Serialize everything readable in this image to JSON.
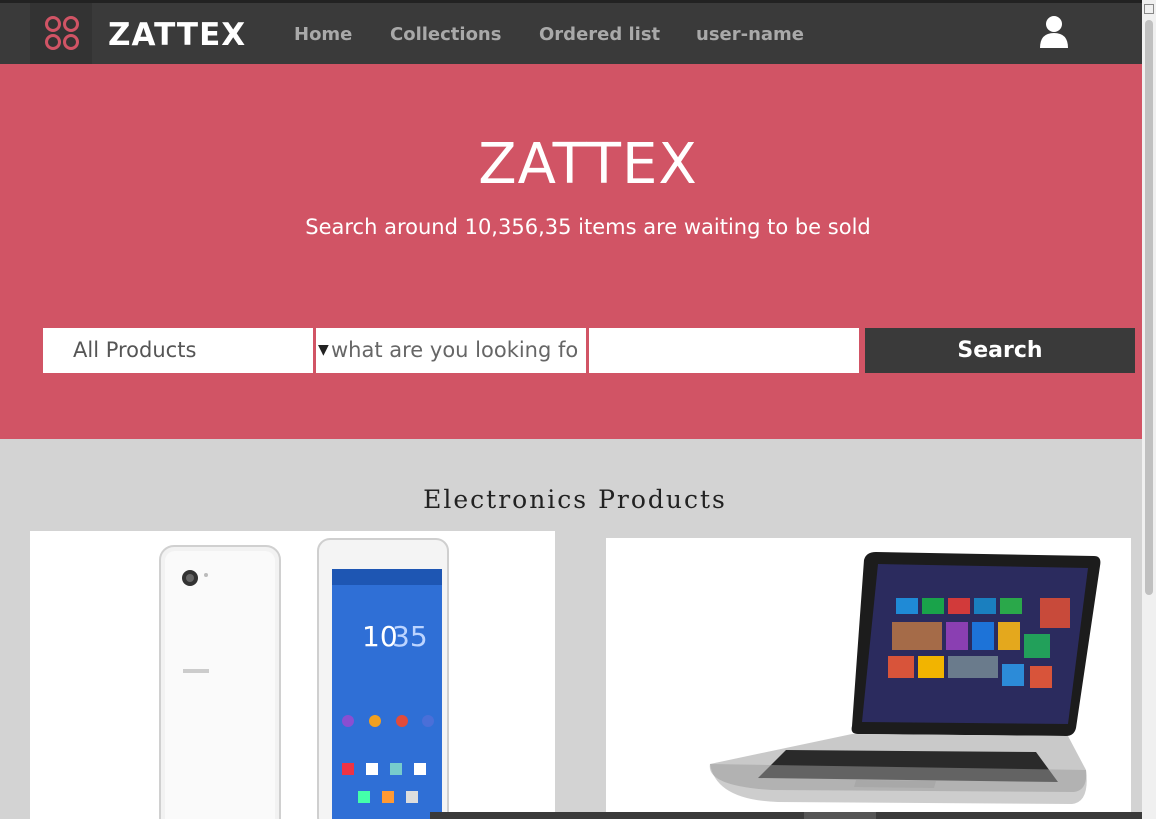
{
  "app": {
    "brand": "ZATTEX",
    "accent": "#d15465",
    "nav_bg": "#3a3a3a",
    "logo_icon": "four-rings-icon",
    "user_icon": "user-icon"
  },
  "nav": {
    "items": [
      {
        "label": "Home"
      },
      {
        "label": "Collections"
      },
      {
        "label": "Ordered list"
      },
      {
        "label": "user-name"
      }
    ]
  },
  "hero": {
    "title": "ZATTEX",
    "subtitle": "Search around 10,356,35 items are waiting to be sold"
  },
  "search": {
    "category_value": "All Products",
    "placeholder": "what are you looking fo",
    "button_label": "Search"
  },
  "section": {
    "title": "Electronics Products",
    "products": [
      {
        "image": "sony-xperia-phone"
      },
      {
        "image": "hp-laptop"
      }
    ]
  }
}
